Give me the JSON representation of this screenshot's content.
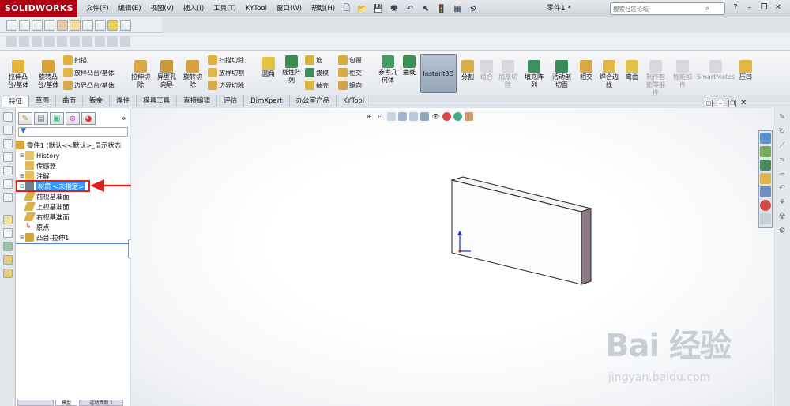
{
  "app": {
    "logo_brand": "SOLIDWORKS",
    "doc_title": "零件1 *"
  },
  "menus": [
    "文件(F)",
    "编辑(E)",
    "视图(V)",
    "插入(I)",
    "工具(T)",
    "KYTool",
    "窗口(W)",
    "帮助(H)"
  ],
  "search": {
    "placeholder": "搜索社区论坛"
  },
  "commands": {
    "extrude_boss": "拉伸凸\n台/基体",
    "revolve_boss": "旋转凸\n台/基体",
    "sweep": "扫描",
    "loft": "放样凸台/基体",
    "boundary_boss": "边界凸台/基体",
    "extrude_cut": "拉伸切\n除",
    "hole_wizard": "异型孔\n向导",
    "revolve_cut": "旋转切\n除",
    "sweep_cut": "扫描切除",
    "loft_cut": "放样切割",
    "boundary_cut": "边界切除",
    "fillet": "圆角",
    "linear_pattern": "线性阵\n列",
    "rib": "筋",
    "draft": "拔模",
    "shell": "抽壳",
    "wrap": "包覆",
    "intersect": "相交",
    "mirror": "镜向",
    "ref_geometry": "参考几\n何体",
    "curves": "曲线",
    "instant3d": "Instant3D",
    "split": "分割",
    "combine": "组合",
    "thicken_cut": "加厚切\n除",
    "fill_pattern": "填充阵\n列",
    "live_section": "活动剖\n切面",
    "intersect2": "相交",
    "weld_bead": "焊合边\n线",
    "flex": "弯曲",
    "make_smart": "制作智\n能零部\n件",
    "smart_fastener": "智能扣\n件",
    "smartmates": "SmartMates",
    "indent": "压凹"
  },
  "tabs": [
    "特征",
    "草图",
    "曲面",
    "钣金",
    "焊件",
    "模具工具",
    "直接编辑",
    "评估",
    "DimXpert",
    "办公室产品",
    "KYTool"
  ],
  "tree": {
    "root": "零件1 (默认<<默认>_显示状态",
    "items": [
      "History",
      "传感器",
      "注解",
      "材质 <未指定>",
      "前视基准面",
      "上视基准面",
      "右视基准面",
      "原点",
      "凸台-拉伸1"
    ]
  },
  "bottom_tabs": [
    "模型",
    "运动算例 1"
  ],
  "watermark": {
    "brand": "Bai 经验",
    "url": "jingyan.baidu.com"
  },
  "colors": {
    "title_red": "#b00012",
    "selection_blue": "#3399ff",
    "arrow_red": "#e02020"
  }
}
